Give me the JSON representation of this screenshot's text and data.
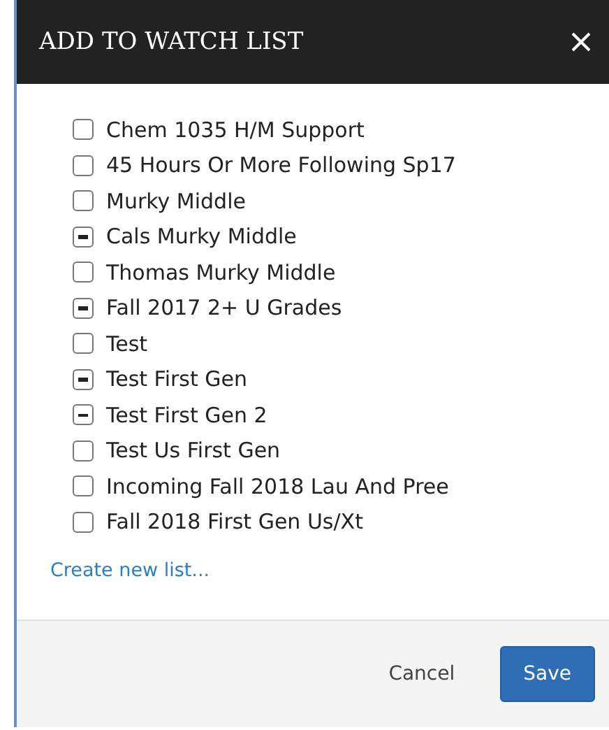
{
  "dialog": {
    "title": "ADD TO WATCH LIST"
  },
  "lists": [
    {
      "label": "Chem 1035 H/M Support",
      "indeterminate": false
    },
    {
      "label": "45 Hours Or More Following Sp17",
      "indeterminate": false
    },
    {
      "label": "Murky Middle",
      "indeterminate": false
    },
    {
      "label": "Cals Murky Middle",
      "indeterminate": true
    },
    {
      "label": "Thomas Murky Middle",
      "indeterminate": false
    },
    {
      "label": "Fall 2017 2+ U Grades",
      "indeterminate": true
    },
    {
      "label": "Test",
      "indeterminate": false
    },
    {
      "label": "Test First Gen",
      "indeterminate": true
    },
    {
      "label": "Test First Gen 2",
      "indeterminate": true
    },
    {
      "label": "Test Us First Gen",
      "indeterminate": false
    },
    {
      "label": "Incoming Fall 2018 Lau And Pree",
      "indeterminate": false
    },
    {
      "label": "Fall 2018 First Gen Us/Xt",
      "indeterminate": false
    }
  ],
  "create_link": "Create new list...",
  "buttons": {
    "cancel": "Cancel",
    "save": "Save"
  }
}
